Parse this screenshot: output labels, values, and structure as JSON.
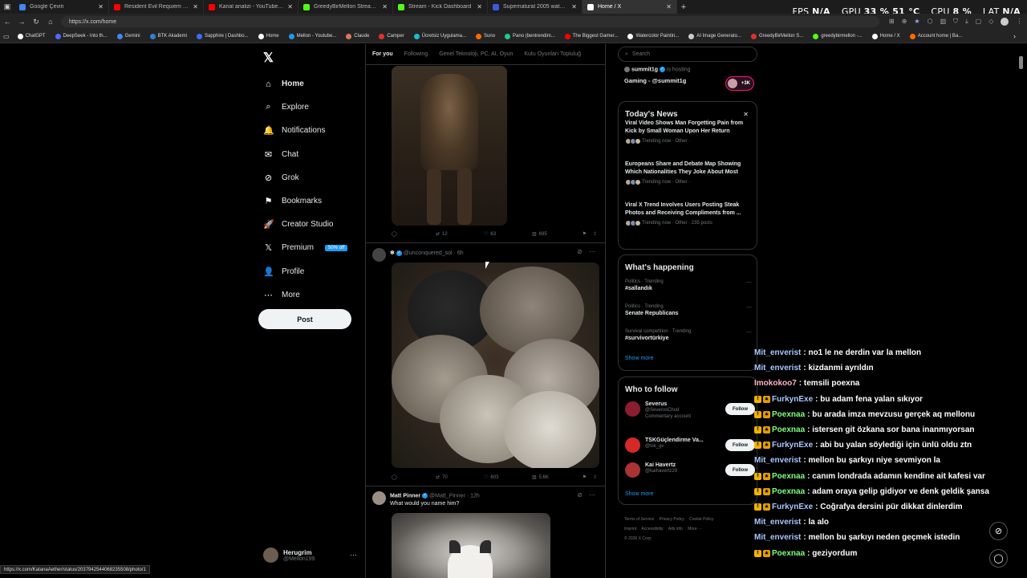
{
  "browser": {
    "tabs": [
      {
        "title": "Google Çeviri",
        "color": "#4285f4",
        "active": false
      },
      {
        "title": "Resident Evil Requiem - Bölüm 5...",
        "color": "#ff0000",
        "active": false
      },
      {
        "title": "Kanal analizi - YouTube Studio",
        "color": "#ff0000",
        "active": false
      },
      {
        "title": "GreedyBirMellon Stream - Watch...",
        "color": "#53fc18",
        "active": false
      },
      {
        "title": "Stream - Kick Dashboard",
        "color": "#53fc18",
        "active": false
      },
      {
        "title": "Supernatural 2005 watch free - 1x...",
        "color": "#3b5bdb",
        "active": false
      },
      {
        "title": "Home / X",
        "color": "#ffffff",
        "active": true
      }
    ],
    "perf": {
      "fps_label": "FPS",
      "fps": "N/A",
      "gpu_label": "GPU",
      "gpu": "33 % 51 °C",
      "cpu_label": "CPU",
      "cpu": "8 %",
      "lat_label": "LAT",
      "lat": "N/A"
    },
    "url": "https://x.com/home",
    "bookmarks": [
      {
        "label": "ChatGPT",
        "color": "#ffffff"
      },
      {
        "label": "DeepSeek - Into th...",
        "color": "#4d6bfe"
      },
      {
        "label": "Gemini",
        "color": "#4285f4"
      },
      {
        "label": "BTK Akademi",
        "color": "#2f7fd6"
      },
      {
        "label": "Sapphire | Dashbo...",
        "color": "#3b6cff"
      },
      {
        "label": "Home",
        "color": "#ffffff"
      },
      {
        "label": "Mellon - Youtube...",
        "color": "#1d9bf0"
      },
      {
        "label": "Claude",
        "color": "#d97757"
      },
      {
        "label": "Camper",
        "color": "#e03131"
      },
      {
        "label": "Ücretsiz Uygulama...",
        "color": "#22b8cf"
      },
      {
        "label": "Suno",
        "color": "#ff6b00"
      },
      {
        "label": "Pano (bentrendim...",
        "color": "#20c997"
      },
      {
        "label": "The Biggest Gamer...",
        "color": "#ff0000"
      },
      {
        "label": "Watercolor Paintin...",
        "color": "#ffffff"
      },
      {
        "label": "AI Image Generato...",
        "color": "#cccccc"
      },
      {
        "label": "GreedyBirMellon S...",
        "color": "#e03131"
      },
      {
        "label": "greedybirmellon -...",
        "color": "#53fc18"
      },
      {
        "label": "Home / X",
        "color": "#ffffff"
      },
      {
        "label": "Account home | Ba...",
        "color": "#ff6b00"
      }
    ],
    "status_url": "https://x.com/KatanaAether/status/2037942544068235508/photo/1"
  },
  "sidebar": {
    "logo": "𝕏",
    "items": [
      {
        "label": "Home",
        "icon": "⌂"
      },
      {
        "label": "Explore",
        "icon": "⌕"
      },
      {
        "label": "Notifications",
        "icon": "🔔"
      },
      {
        "label": "Chat",
        "icon": "✉"
      },
      {
        "label": "Grok",
        "icon": "⊘"
      },
      {
        "label": "Bookmarks",
        "icon": "⚑"
      },
      {
        "label": "Creator Studio",
        "icon": "🚀"
      },
      {
        "label": "Premium",
        "icon": "𝕏"
      },
      {
        "label": "Profile",
        "icon": "👤"
      },
      {
        "label": "More",
        "icon": "⋯"
      }
    ],
    "premium_badge": "50% off",
    "post_button": "Post",
    "account": {
      "name": "Herugrim",
      "handle": "@Mellon199",
      "menu": "···"
    }
  },
  "feed": {
    "tabs": [
      "For you",
      "Following",
      "Genel Teknoloji, PC, AI, Oyun",
      "Kutu Oyunları Topluluğ"
    ],
    "post1": {
      "replies": "",
      "reposts": "12",
      "likes": "63",
      "views": "695"
    },
    "post2": {
      "name": "❄",
      "handle": "@unconquered_sol",
      "time": "· 6h",
      "replies": "",
      "reposts": "70",
      "likes": "603",
      "views": "5.6K"
    },
    "post3": {
      "name": "Matt Pinner",
      "handle": "@Matt_Pinner",
      "time": "· 12h",
      "text": "What would you name him?"
    }
  },
  "right": {
    "search_placeholder": "Search",
    "host": {
      "name": "summit1g",
      "status": "is hosting",
      "title": "Gaming - @summit1g",
      "listeners": "+3K"
    },
    "news": {
      "title": "Today's News",
      "close": "✕",
      "items": [
        {
          "title": "Viral Video Shows Man Forgetting Pain from Kick by Small Woman Upon Her Return",
          "meta": "Trending now · Other ·"
        },
        {
          "title": "Europeans Share and Debate Map Showing Which Nationalities They Joke About Most",
          "meta": "Trending now · Other ·"
        },
        {
          "title": "Viral X Trend Involves Users Posting Steak Photos and Receiving Compliments from ...",
          "meta": "Trending now · Other · 235 posts"
        }
      ]
    },
    "happening": {
      "title": "What's happening",
      "items": [
        {
          "category": "Politics · Trending",
          "name": "#sallandık"
        },
        {
          "category": "Politics · Trending",
          "name": "Senate Republicans"
        },
        {
          "category": "Survival competition · Trending",
          "name": "#survivortürkiye"
        }
      ],
      "show_more": "Show more"
    },
    "follow": {
      "title": "Who to follow",
      "items": [
        {
          "name": "Severus",
          "handle": "@SeverusChud",
          "extra": "Commentary account",
          "button": "Follow",
          "color": "#8b1e2e"
        },
        {
          "name": "TSKGüçlendirme Va...",
          "handle": "@tsk_gv",
          "extra": "",
          "button": "Follow",
          "color": "#d62828"
        },
        {
          "name": "Kai Havertz",
          "handle": "@kaihavertz29",
          "extra": "",
          "button": "Follow",
          "color": "#a33"
        }
      ],
      "show_more": "Show more"
    },
    "footer": [
      "Terms of Service",
      "Privacy Policy",
      "Cookie Policy",
      "Imprint",
      "Accessibility",
      "Ads info",
      "More ···",
      "© 2026 X Corp."
    ]
  },
  "chat": [
    {
      "user": "Mit_enverist",
      "msg": ": no1 le ne derdin var la mellon",
      "color": "#a8c8ff",
      "badges": false
    },
    {
      "user": "Mit_enverist",
      "msg": ": kizdanmi ayrıldın",
      "color": "#a8c8ff",
      "badges": false
    },
    {
      "user": "Imokokoo7",
      "msg": ": temsili poexna",
      "color": "#ffb3c7",
      "badges": false
    },
    {
      "user": "FurkynExe",
      "msg": ": bu adam fena yalan sıkıyor",
      "color": "#a8c8ff",
      "badges": true
    },
    {
      "user": "Poexnaa",
      "msg": ": bu arada imza mevzusu gerçek aq mellonu",
      "color": "#7dff7d",
      "badges": true
    },
    {
      "user": "Poexnaa",
      "msg": ": istersen git özkana sor bana inanmıyorsan",
      "color": "#7dff7d",
      "badges": true
    },
    {
      "user": "FurkynExe",
      "msg": ": abi bu yalan söylediği için ünlü oldu ztn",
      "color": "#a8c8ff",
      "badges": true
    },
    {
      "user": "Mit_enverist",
      "msg": ": mellon bu şarkıyı niye sevmiyon la",
      "color": "#a8c8ff",
      "badges": false
    },
    {
      "user": "Poexnaa",
      "msg": ": canım londrada adamın kendine ait kafesi var",
      "color": "#7dff7d",
      "badges": true
    },
    {
      "user": "Poexnaa",
      "msg": ": adam oraya gelip gidiyor ve denk geldik şansa",
      "color": "#7dff7d",
      "badges": true
    },
    {
      "user": "FurkynExe",
      "msg": ": Coğrafya dersini pür dikkat dinlerdim",
      "color": "#a8c8ff",
      "badges": true
    },
    {
      "user": "Mit_enverist",
      "msg": ": la alo",
      "color": "#a8c8ff",
      "badges": false
    },
    {
      "user": "Mit_enverist",
      "msg": ": mellon bu şarkıyı neden geçmek istedin",
      "color": "#a8c8ff",
      "badges": false
    },
    {
      "user": "Poexnaa",
      "msg": ": geziyordum",
      "color": "#7dff7d",
      "badges": true
    }
  ],
  "fab": {
    "grok_icon": "⊘",
    "chat_icon": "◯"
  }
}
